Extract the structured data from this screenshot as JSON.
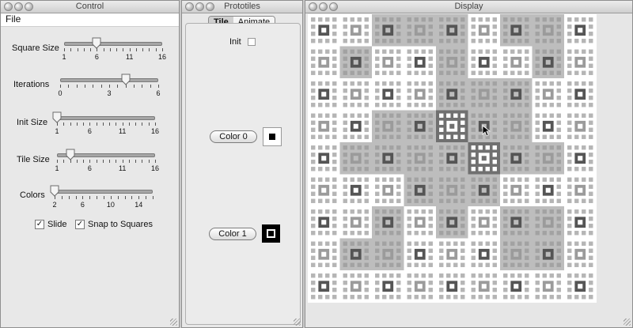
{
  "control": {
    "title": "Control",
    "menu": {
      "file": "File"
    },
    "sliders": [
      {
        "label": "Square Size",
        "ticks": [
          "1",
          "6",
          "11",
          "16"
        ],
        "value": 6,
        "min": 1,
        "max": 16
      },
      {
        "label": "Iterations",
        "ticks": [
          "0",
          "3",
          "6"
        ],
        "value": 4,
        "min": 0,
        "max": 6
      },
      {
        "label": "Init Size",
        "ticks": [
          "1",
          "6",
          "11",
          "16"
        ],
        "value": 1,
        "min": 1,
        "max": 16
      },
      {
        "label": "Tile Size",
        "ticks": [
          "1",
          "6",
          "11",
          "16"
        ],
        "value": 3,
        "min": 1,
        "max": 16
      },
      {
        "label": "Colors",
        "ticks": [
          "2",
          "6",
          "10",
          "14"
        ],
        "value": 2,
        "min": 2,
        "max": 16
      }
    ],
    "checkboxes": {
      "slide": "Slide",
      "slide_checked": true,
      "snap": "Snap to Squares",
      "snap_checked": true
    }
  },
  "prototiles": {
    "title": "Prototiles",
    "tabs": {
      "tile": "Tile",
      "animate": "Animate"
    },
    "init_label": "Init",
    "color0": "Color 0",
    "color1": "Color 1"
  },
  "display": {
    "title": "Display"
  }
}
